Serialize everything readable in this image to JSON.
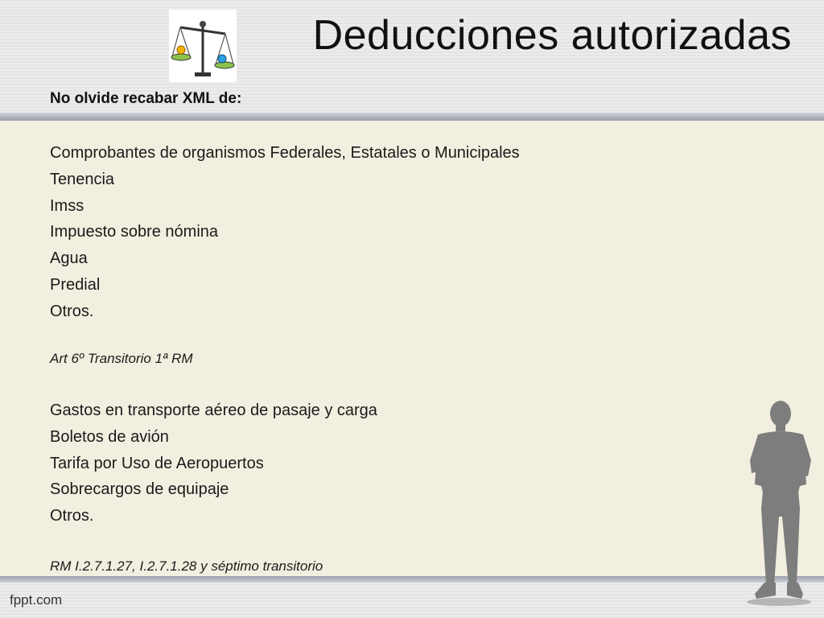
{
  "title": "Deducciones autorizadas",
  "subtitle": "No olvide recabar XML de:",
  "list1": [
    "Comprobantes de organismos Federales, Estatales o Municipales",
    "Tenencia",
    "Imss",
    "Impuesto sobre nómina",
    "Agua",
    "Predial",
    "Otros."
  ],
  "ref1": "Art 6º Transitorio 1ª RM",
  "list2": [
    "Gastos en transporte aéreo de pasaje y carga",
    "Boletos de avión",
    "Tarifa por Uso de Aeropuertos",
    "Sobrecargos de equipaje",
    "Otros."
  ],
  "ref2": "RM I.2.7.1.27, I.2.7.1.28 y séptimo transitorio",
  "footer": "fppt.com",
  "logo_icon": "scales-of-justice-icon",
  "figure_icon": "person-silhouette-icon"
}
